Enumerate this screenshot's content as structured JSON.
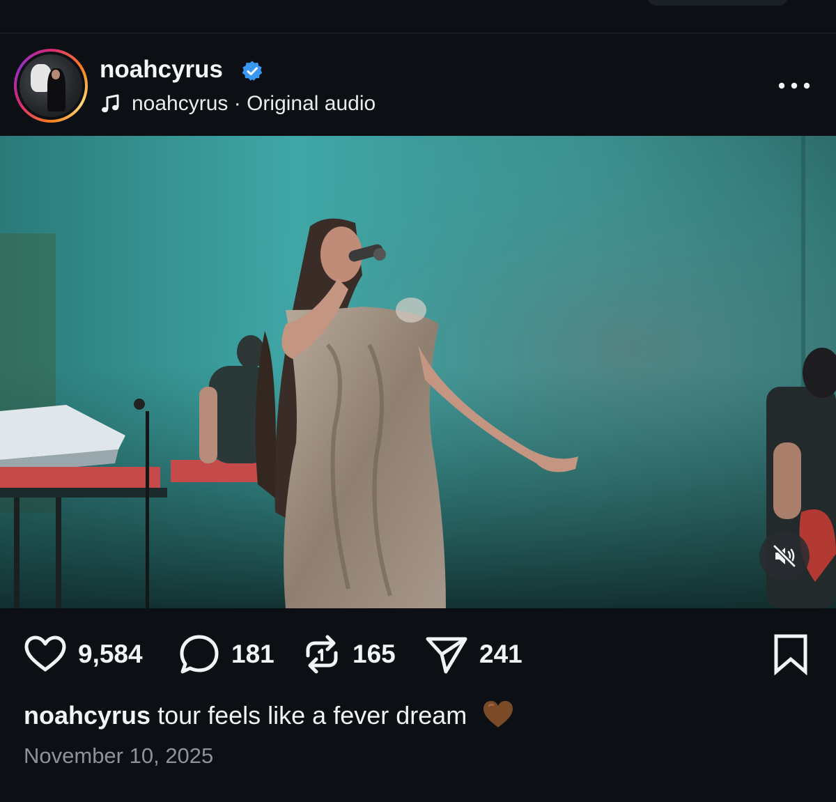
{
  "post": {
    "username": "noahcyrus",
    "verified": true,
    "audio_label": "noahcyrus · Original audio"
  },
  "icons": {
    "avatar": "profile-photo",
    "verified": "verified-badge-icon",
    "audio": "music-note-icon",
    "more": "more-options-icon",
    "mute": "speaker-muted-icon",
    "like": "heart-icon",
    "comment": "comment-bubble-icon",
    "repost": "repost-arrows-icon",
    "share": "paper-plane-icon",
    "save": "bookmark-icon"
  },
  "stats": {
    "likes": "9,584",
    "comments": "181",
    "reposts": "165",
    "shares": "241"
  },
  "caption": {
    "username": "noahcyrus",
    "text": "tour feels like a fever dream",
    "emoji": "brown-heart"
  },
  "date": "November 10, 2025",
  "colors": {
    "background": "#0c0f14",
    "verified_blue": "#3897f0",
    "text": "#f2f4f7",
    "muted_text": "#8d939c",
    "stage_teal": "#3fa6a6",
    "brown_heart": "#7b4a26"
  }
}
